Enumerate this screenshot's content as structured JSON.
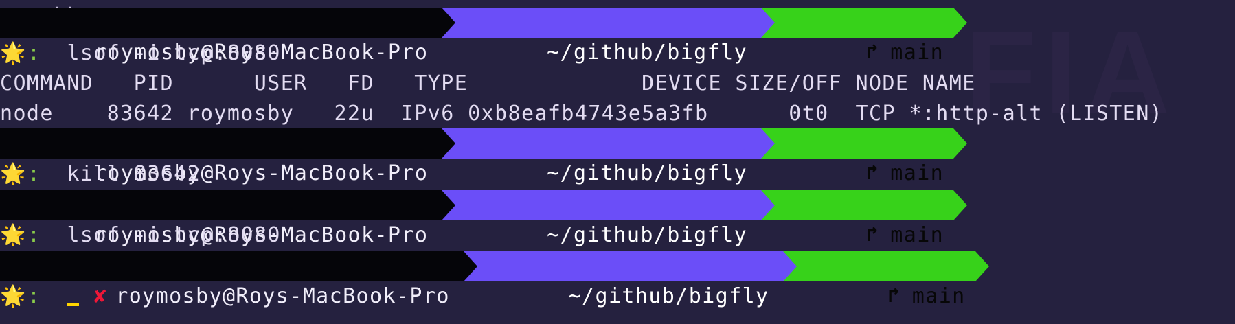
{
  "colors": {
    "background": "#25213f",
    "user_segment": "#050509",
    "path_segment": "#6b4ef8",
    "git_segment": "#37d21a",
    "error_mark": "#ef1738",
    "cursor": "#ffd400",
    "prompt_colon": "#8acc4a"
  },
  "terminal": {
    "top_artifact": "LL",
    "watermark": "FIA",
    "prompt": {
      "user_host": "roymosby@Roys-MacBook-Pro",
      "path": "~/github/bigfly",
      "branch_icon": "↱",
      "branch": "main",
      "star_icon": "🌟",
      "colon": ":",
      "error_icon": "✘"
    },
    "commands": {
      "first": "lsof -i tcp:8080",
      "second": "kill 83642",
      "third": "lsof -i tcp:8080",
      "fourth": ""
    },
    "output": {
      "header": "COMMAND   PID      USER   FD   TYPE             DEVICE SIZE/OFF NODE NAME",
      "row": "node    83642 roymosby   22u  IPv6 0xb8eafb4743e5a3fb      0t0  TCP *:http-alt (LISTEN)"
    }
  }
}
